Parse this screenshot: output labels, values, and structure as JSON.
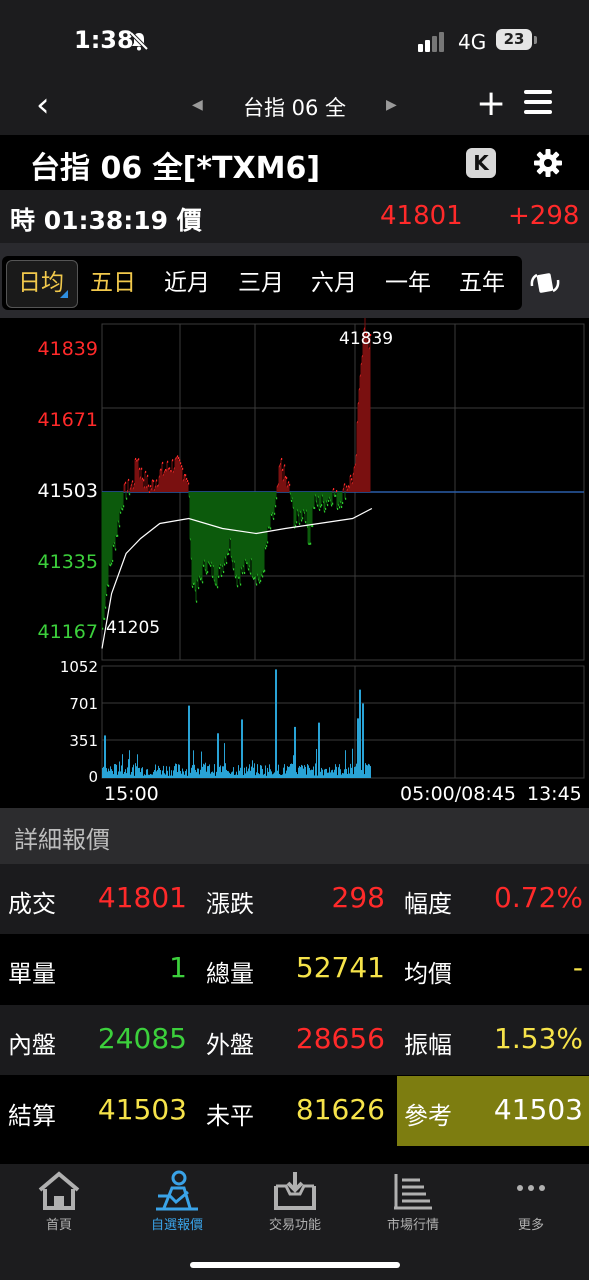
{
  "status_bar": {
    "time": "1:38",
    "network": "4G",
    "battery": "23"
  },
  "nav": {
    "title": "台指 06 全"
  },
  "header": {
    "title": "台指 06 全[*TXM6]",
    "k_button": "K"
  },
  "quote": {
    "time_label": "時 01:38:19 價",
    "price": "41801",
    "change": "+298"
  },
  "tabs": [
    {
      "label": "日均",
      "active": true
    },
    {
      "label": "五日",
      "active": false
    },
    {
      "label": "近月",
      "active": false
    },
    {
      "label": "三月",
      "active": false
    },
    {
      "label": "六月",
      "active": false
    },
    {
      "label": "一年",
      "active": false
    },
    {
      "label": "五年",
      "active": false
    }
  ],
  "chart": {
    "price_ticks": [
      "41839",
      "41671",
      "41503",
      "41335",
      "41167"
    ],
    "high_label": "41839",
    "low_label": "41205",
    "volume_ticks": [
      "1052",
      "701",
      "351",
      "0"
    ],
    "x_labels": [
      "15:00",
      "05:00/08:45",
      "13:45"
    ],
    "colors": {
      "up": "#ff2a2a",
      "down": "#2ecc2e",
      "reference": "#2a5da8",
      "volume": "#29a3d6",
      "average": "#ffffff"
    }
  },
  "chart_data": {
    "type": "line",
    "reference": 41503,
    "high": 41839,
    "low": 41205,
    "ylim": [
      41167,
      41839
    ],
    "volume_ylim": [
      0,
      1052
    ],
    "x_labels": [
      "15:00",
      "05:00/08:45",
      "13:45"
    ]
  },
  "detail": {
    "title": "詳細報價",
    "rows": [
      [
        {
          "label": "成交",
          "value": "41801",
          "color": "red"
        },
        {
          "label": "漲跌",
          "value": "298",
          "color": "red"
        },
        {
          "label": "幅度",
          "value": "0.72%",
          "color": "red"
        }
      ],
      [
        {
          "label": "單量",
          "value": "1",
          "color": "green"
        },
        {
          "label": "總量",
          "value": "52741",
          "color": "yellow"
        },
        {
          "label": "均價",
          "value": "-",
          "color": "yellow"
        }
      ],
      [
        {
          "label": "內盤",
          "value": "24085",
          "color": "green"
        },
        {
          "label": "外盤",
          "value": "28656",
          "color": "red"
        },
        {
          "label": "振幅",
          "value": "1.53%",
          "color": "yellow"
        }
      ],
      [
        {
          "label": "結算",
          "value": "41503",
          "color": "yellow"
        },
        {
          "label": "未平",
          "value": "81626",
          "color": "yellow"
        },
        {
          "label": "參考",
          "value": "41503",
          "color": "white"
        }
      ]
    ]
  },
  "bottom_tabs": [
    {
      "label": "首頁",
      "icon": "home-icon"
    },
    {
      "label": "自選報價",
      "icon": "watchlist-icon",
      "active": true
    },
    {
      "label": "交易功能",
      "icon": "trade-icon"
    },
    {
      "label": "市場行情",
      "icon": "market-icon"
    },
    {
      "label": "更多",
      "icon": "more-icon"
    }
  ]
}
